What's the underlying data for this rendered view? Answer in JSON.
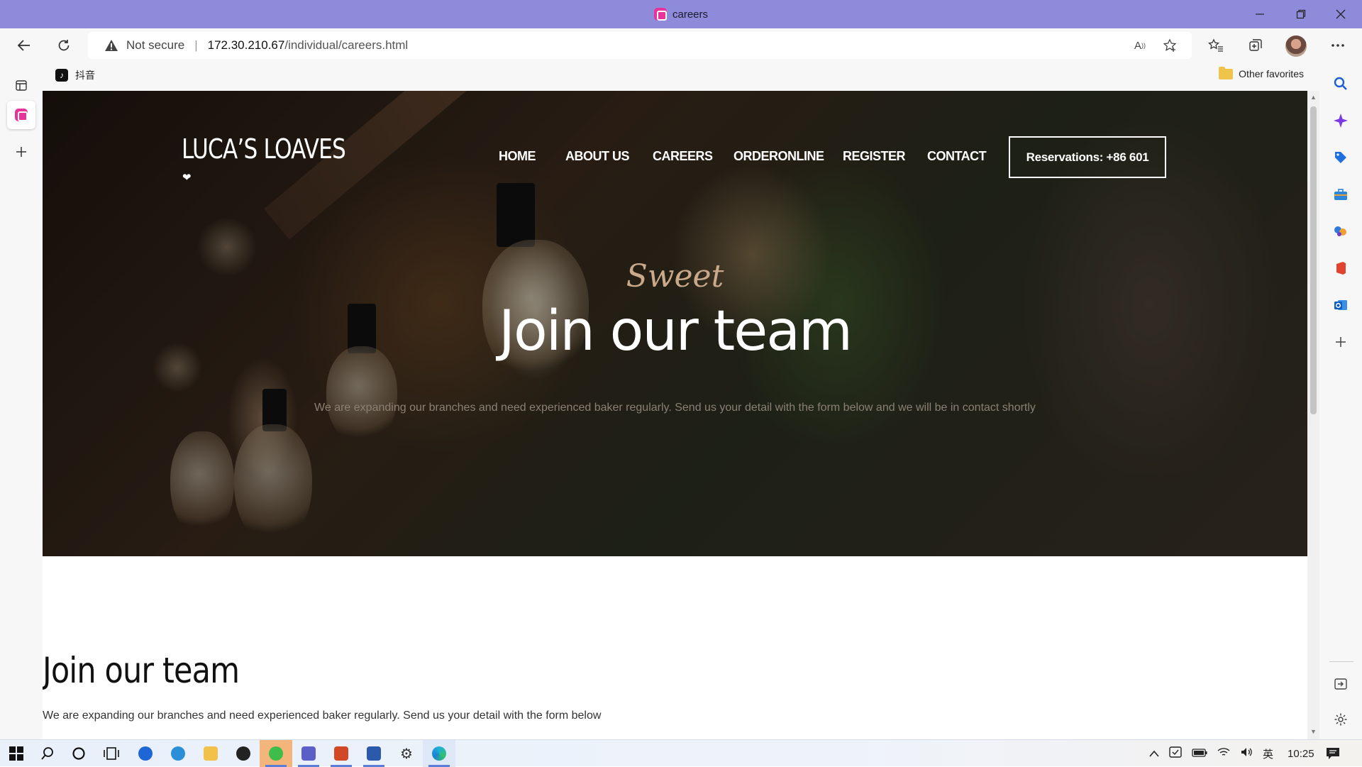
{
  "browser": {
    "tab_title": "careers",
    "url_warning": "Not secure",
    "url_host": "172.30.210.67",
    "url_path": "/individual/careers.html",
    "favorites": [
      {
        "label": "抖音"
      }
    ],
    "other_favorites": "Other favorites"
  },
  "site": {
    "brand": "LUCA’S LOAVES",
    "heart": "❤",
    "menu": [
      "HOME",
      "ABOUT US",
      "CAREERS",
      "ORDERONLINE",
      "REGISTER",
      "CONTACT"
    ],
    "reservation": "Reservations: +86 601",
    "hero": {
      "script": "Sweet",
      "title": "Join our team",
      "subtitle": "We are expanding our branches and need experienced baker regularly. Send us your detail with the form below and we will be in contact shortly"
    },
    "section": {
      "title": "Join our team",
      "text": "We are expanding our branches and need experienced baker regularly. Send us your detail with the form below"
    }
  },
  "taskbar": {
    "ime": "英",
    "clock": "10:25"
  }
}
